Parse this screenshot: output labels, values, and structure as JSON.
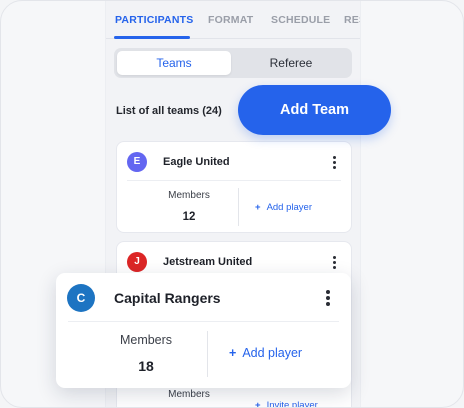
{
  "tabs": [
    "PARTICIPANTS",
    "FORMAT",
    "SCHEDULE",
    "RES"
  ],
  "segmented": {
    "active": "Teams",
    "inactive": "Referee"
  },
  "list_title": "List of all teams (24)",
  "add_team_label": "Add Team",
  "teams": [
    {
      "initial": "E",
      "name": "Eagle United",
      "members_label": "Members",
      "members": "12",
      "action": "Add player",
      "avatar_color": "#6366f1"
    },
    {
      "initial": "J",
      "name": "Jetstream United",
      "members_label": "Members",
      "members": "",
      "action": "Invite player",
      "avatar_color": "#dc2626"
    }
  ],
  "highlight_team": {
    "initial": "C",
    "name": "Capital Rangers",
    "members_label": "Members",
    "members": "18",
    "action": "Add player",
    "avatar_color": "#1d74c2"
  },
  "colors": {
    "accent": "#2563eb"
  }
}
